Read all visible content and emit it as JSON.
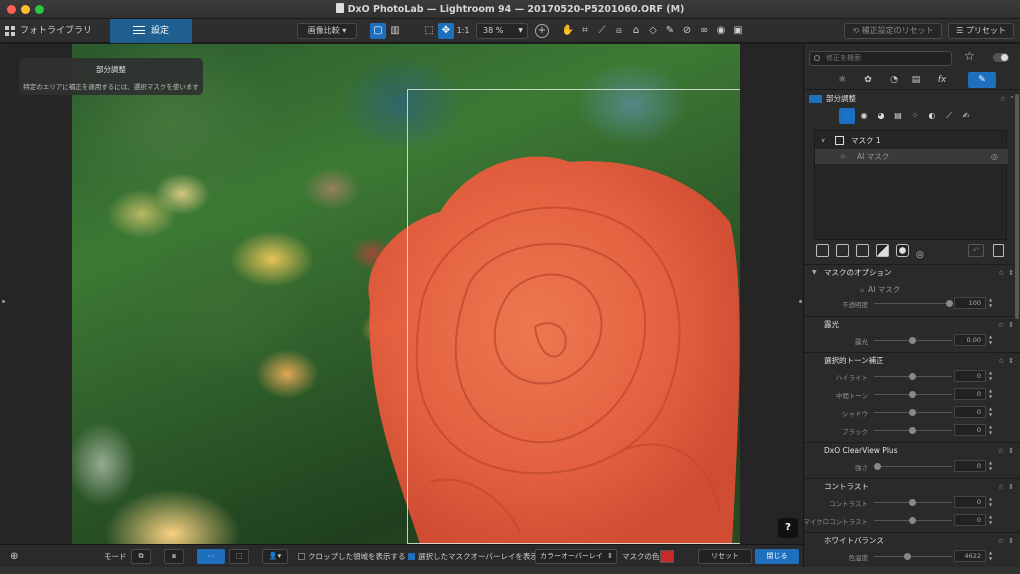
{
  "window": {
    "title": "DxO PhotoLab — Lightroom 94 — 20170520-P5201060.ORF (M)"
  },
  "toolbar": {
    "library_tab": "フォトライブラリ",
    "settings_tab": "設定",
    "compare_label": "画像比較",
    "ratio_label": "1:1",
    "zoom_value": "38 %",
    "reset_corrections": "補正設定のリセット",
    "presets": "プリセット"
  },
  "hint": {
    "title": "部分調整",
    "body": "特定のエリアに補正を適用するには、選択マスクを使います"
  },
  "help_label": "?",
  "bottom": {
    "mode_label": "モード",
    "show_cropped_label": "クロップした領域を表示する",
    "show_overlay_label": "選択したマスクオーバーレイを表示",
    "overlay_mode": "カラーオーバーレイ",
    "mask_color_label": "マスクの色",
    "mask_color": "#c72a2a",
    "reset_label": "リセット",
    "close_label": "閉じる"
  },
  "panel": {
    "search_placeholder": "修正を検索",
    "local_adjust_title": "部分調整",
    "mask_name": "マスク 1",
    "ai_mask_label": "AI マスク",
    "mask_options_title": "マスクのオプション",
    "mask_options_ai": "AI マスク",
    "opacity_label": "不透明度",
    "opacity_value": "100",
    "exposure_title": "露光",
    "exposure_label": "露光",
    "exposure_value": "0.00",
    "tone_title": "選択的トーン補正",
    "tone": [
      {
        "label": "ハイライト",
        "value": "0"
      },
      {
        "label": "中間トーン",
        "value": "0"
      },
      {
        "label": "シャドウ",
        "value": "0"
      },
      {
        "label": "ブラック",
        "value": "0"
      }
    ],
    "clearview_title": "DxO ClearView Plus",
    "clearview_label": "強さ",
    "clearview_value": "0",
    "contrast_title": "コントラスト",
    "contrast_label": "コントラスト",
    "contrast_value": "0",
    "micro_label": "マイクロコントラスト",
    "micro_value": "0",
    "wb_title": "ホワイトバランス",
    "temp_label": "色温度",
    "temp_value": "4622"
  },
  "colors": {
    "accent": "#1f6fbf",
    "mask_overlay": "#f05a3c"
  }
}
